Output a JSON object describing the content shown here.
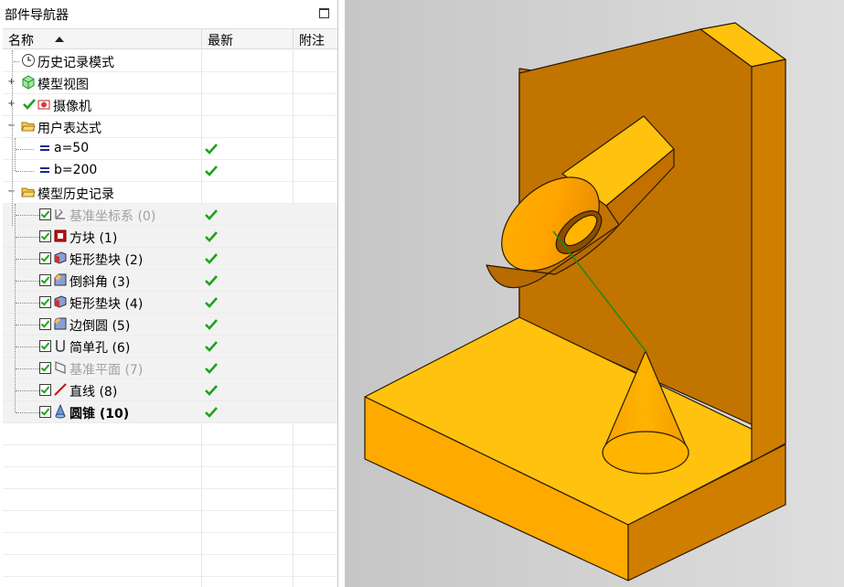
{
  "navigator": {
    "title": "部件导航器",
    "columns": {
      "name": "名称",
      "latest": "最新",
      "note": "附注"
    },
    "items": [
      {
        "label": "历史记录模式",
        "icon": "clock-icon",
        "latest": false,
        "checkbox": false,
        "expander": "",
        "style": "normal"
      },
      {
        "label": "模型视图",
        "icon": "model-views-icon",
        "latest": false,
        "checkbox": false,
        "expander": "+",
        "style": "normal"
      },
      {
        "label": "摄像机",
        "icon": "camera-icon",
        "latest": false,
        "checkbox": false,
        "expander": "+",
        "style": "normal"
      },
      {
        "label": "用户表达式",
        "icon": "folder-open-icon",
        "latest": false,
        "checkbox": false,
        "expander": "-",
        "style": "normal"
      },
      {
        "label": "a=50",
        "icon": "expression-icon",
        "latest": true,
        "checkbox": false,
        "expander": "",
        "style": "normal"
      },
      {
        "label": "b=200",
        "icon": "expression-icon",
        "latest": true,
        "checkbox": false,
        "expander": "",
        "style": "normal"
      },
      {
        "label": "模型历史记录",
        "icon": "folder-open-icon",
        "latest": false,
        "checkbox": false,
        "expander": "-",
        "style": "normal"
      },
      {
        "label": "基准坐标系 (0)",
        "icon": "datum-csys-icon",
        "latest": true,
        "checkbox": true,
        "expander": "",
        "style": "grey"
      },
      {
        "label": "方块 (1)",
        "icon": "block-icon",
        "latest": true,
        "checkbox": true,
        "expander": "",
        "style": "normal"
      },
      {
        "label": "矩形垫块 (2)",
        "icon": "pad-icon",
        "latest": true,
        "checkbox": true,
        "expander": "",
        "style": "normal"
      },
      {
        "label": "倒斜角 (3)",
        "icon": "chamfer-icon",
        "latest": true,
        "checkbox": true,
        "expander": "",
        "style": "normal"
      },
      {
        "label": "矩形垫块 (4)",
        "icon": "pad-icon",
        "latest": true,
        "checkbox": true,
        "expander": "",
        "style": "normal"
      },
      {
        "label": "边倒圆 (5)",
        "icon": "edge-blend-icon",
        "latest": true,
        "checkbox": true,
        "expander": "",
        "style": "normal"
      },
      {
        "label": "简单孔 (6)",
        "icon": "hole-icon",
        "latest": true,
        "checkbox": true,
        "expander": "",
        "style": "normal"
      },
      {
        "label": "基准平面 (7)",
        "icon": "datum-plane-icon",
        "latest": true,
        "checkbox": true,
        "expander": "",
        "style": "grey"
      },
      {
        "label": "直线 (8)",
        "icon": "line-icon",
        "latest": true,
        "checkbox": true,
        "expander": "",
        "style": "normal"
      },
      {
        "label": "圆锥 (10)",
        "icon": "cone-icon",
        "latest": true,
        "checkbox": true,
        "expander": "",
        "style": "bold"
      }
    ]
  },
  "colors": {
    "part_face_light": "#FFC20E",
    "part_face_mid": "#F0A800",
    "part_face_dark": "#CC7A00",
    "latest_check": "#1AA51A",
    "viewport_bg": "#D3D3D3"
  }
}
